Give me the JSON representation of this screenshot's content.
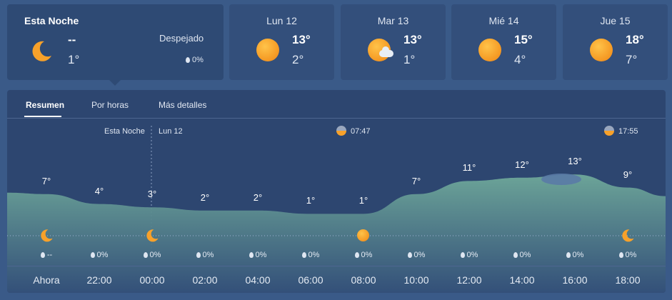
{
  "tonight": {
    "title": "Esta Noche",
    "high": "--",
    "low": "1°",
    "condition": "Despejado",
    "precip": "0%",
    "icon": "moon-icon"
  },
  "days": [
    {
      "name": "Lun 12",
      "high": "13°",
      "low": "2°",
      "icon": "sun-icon"
    },
    {
      "name": "Mar 13",
      "high": "13°",
      "low": "1°",
      "icon": "sun-cloud-icon"
    },
    {
      "name": "Mié 14",
      "high": "15°",
      "low": "4°",
      "icon": "sun-icon"
    },
    {
      "name": "Jue 15",
      "high": "18°",
      "low": "7°",
      "icon": "sun-icon"
    }
  ],
  "tabs": [
    "Resumen",
    "Por horas",
    "Más detalles"
  ],
  "timeline": {
    "label_tonight": "Esta Noche",
    "label_day": "Lun 12",
    "sunrise": "07:47",
    "sunset": "17:55"
  },
  "hours": [
    "Ahora",
    "22:00",
    "00:00",
    "02:00",
    "04:00",
    "06:00",
    "08:00",
    "10:00",
    "12:00",
    "14:00",
    "16:00",
    "18:00"
  ],
  "temps": [
    "7°",
    "4°",
    "3°",
    "2°",
    "2°",
    "1°",
    "1°",
    "7°",
    "11°",
    "12°",
    "13°",
    "9°"
  ],
  "temp_values": [
    7,
    4,
    3,
    2,
    2,
    1,
    1,
    7,
    11,
    12,
    13,
    9
  ],
  "precip": [
    "--",
    "0%",
    "0%",
    "0%",
    "0%",
    "0%",
    "0%",
    "0%",
    "0%",
    "0%",
    "0%",
    "0%"
  ],
  "colors": {
    "sun": "#f7a12a",
    "curve_top": "#6fa99a",
    "background": "#3a5a88"
  }
}
